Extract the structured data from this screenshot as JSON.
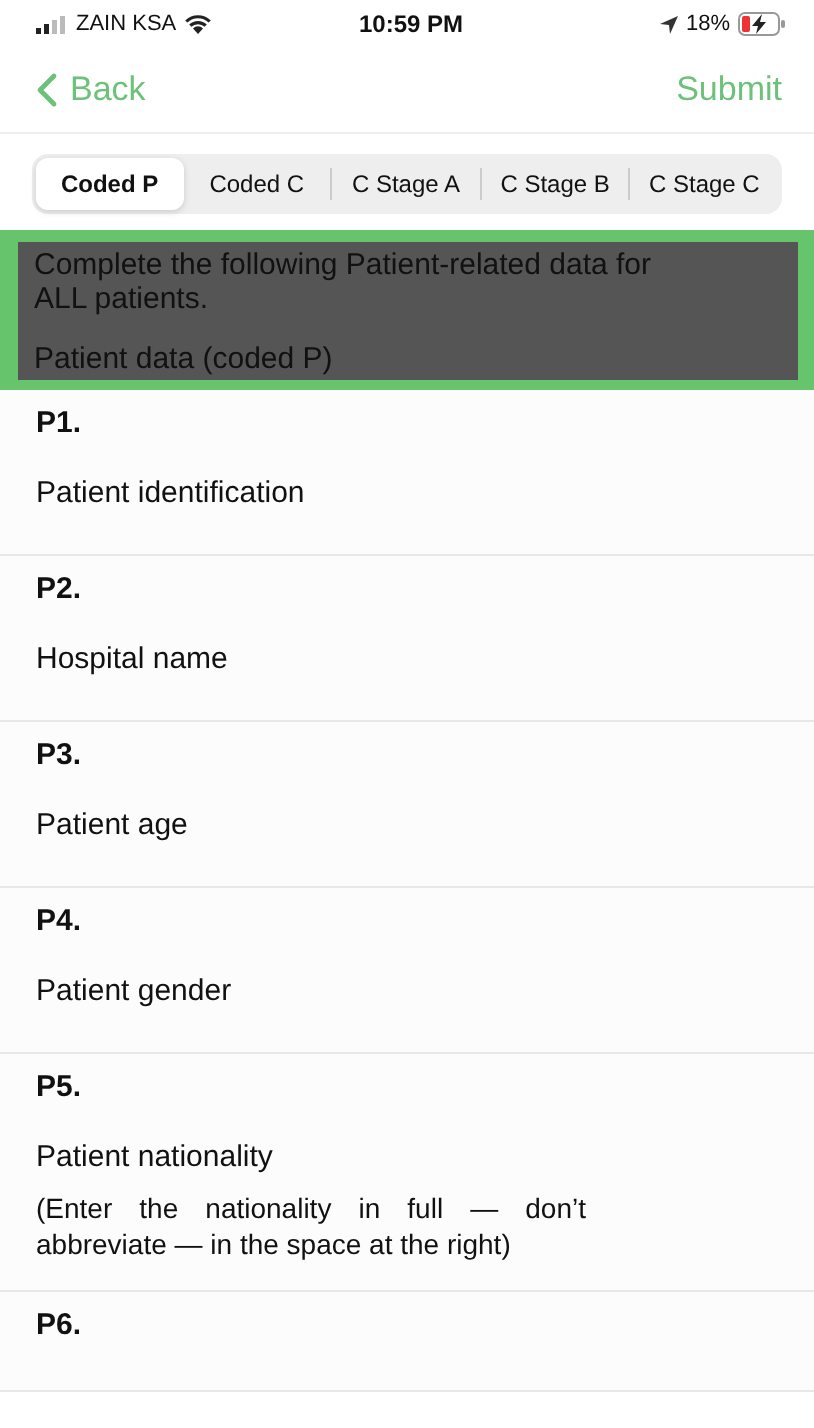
{
  "status_bar": {
    "carrier": "ZAIN KSA",
    "time": "10:59 PM",
    "battery": "18%"
  },
  "nav": {
    "back": "Back",
    "action": "Submit"
  },
  "tabs": [
    {
      "label": "Coded P",
      "selected": true
    },
    {
      "label": "Coded C",
      "selected": false
    },
    {
      "label": "C Stage A",
      "selected": false
    },
    {
      "label": "C Stage B",
      "selected": false
    },
    {
      "label": "C Stage C",
      "selected": false
    }
  ],
  "banner": {
    "text": "Complete the following Patient-related data for ALL patients.",
    "subtitle": "Patient data (coded P)"
  },
  "questions": [
    {
      "code": "P1.",
      "label": "Patient identification"
    },
    {
      "code": "P2.",
      "label": "Hospital name"
    },
    {
      "code": "P3.",
      "label": "Patient age"
    },
    {
      "code": "P4.",
      "label": "Patient gender"
    },
    {
      "code": "P5.",
      "label": "Patient nationality",
      "note": "(Enter the nationality in full — don’t abbreviate — in the space at the right)"
    },
    {
      "code": "P6."
    }
  ]
}
